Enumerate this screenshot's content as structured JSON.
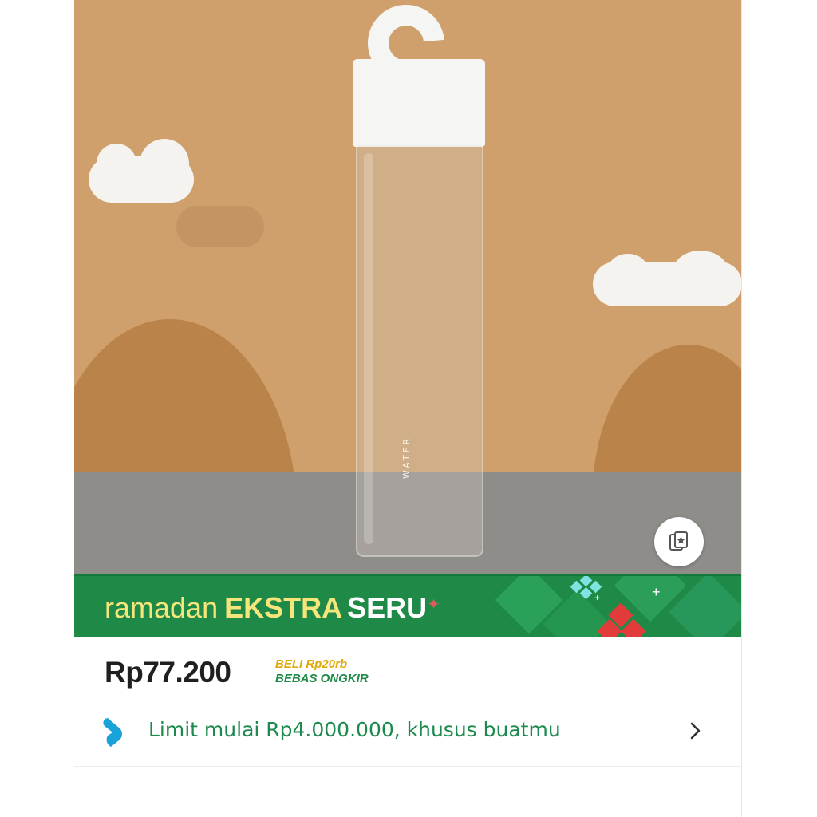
{
  "product_image": {
    "bottle_print": "WATER"
  },
  "promo_banner": {
    "word1": "ramadan",
    "word2": "EKSTRA",
    "word3": "SERU"
  },
  "pricing": {
    "price": "Rp77.200",
    "shipping_line1": "BELI Rp20rb",
    "shipping_line2": "BEBAS ONGKIR"
  },
  "paylater": {
    "text": "Limit mulai Rp4.000.000, khusus buatmu"
  },
  "icons": {
    "favorite": "bookmark-star-icon",
    "paylater": "paylater-drop-icon",
    "chevron": "chevron-right-icon"
  },
  "colors": {
    "banner_green": "#1f8a48",
    "banner_yellow": "#f6e57a",
    "price_text": "#1f1f1f",
    "shipping_yellow": "#e0a800",
    "shipping_green": "#1f8a48",
    "paylater_text": "#1b8a4c",
    "paylater_icon": "#1aa3d9",
    "background_tan": "#cfa06b"
  }
}
